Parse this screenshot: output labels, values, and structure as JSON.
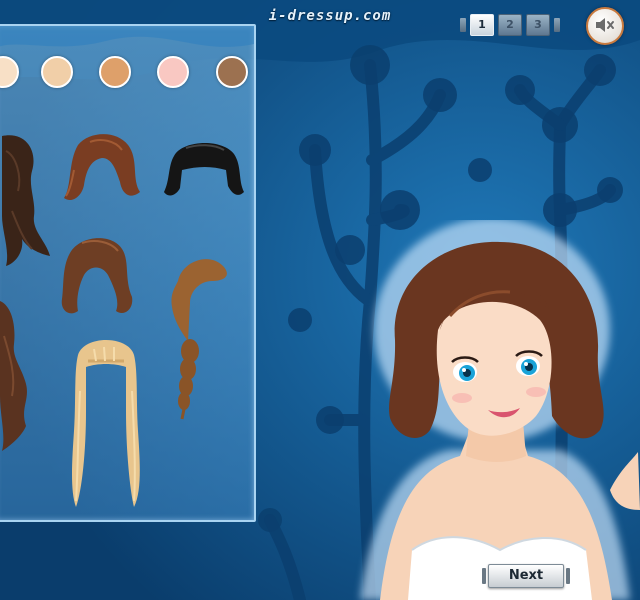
{
  "game": {
    "logo_text": "i-dressup.com",
    "pages": [
      "1",
      "2",
      "3"
    ],
    "active_page": 0,
    "next_label": "Next",
    "sound_icon": "speaker-mute-icon"
  },
  "colors": {
    "background": "#0e4f86",
    "panel_border": "#a9d4f2",
    "accent_orange": "#c97a3e"
  },
  "skin_tones": [
    "#f8e0c6",
    "#f1cfa8",
    "#dea06a",
    "#f9c8c2",
    "#9c7150"
  ],
  "hairstyles": [
    {
      "name": "dark-long-wavy",
      "color": "#3a2418"
    },
    {
      "name": "auburn-bob",
      "color": "#7a3d22"
    },
    {
      "name": "black-bob-bangs",
      "color": "#151515"
    },
    {
      "name": "brown-long-wavy",
      "color": "#5a3320"
    },
    {
      "name": "brown-medium-flip",
      "color": "#6e3e24"
    },
    {
      "name": "light-brown-braid",
      "color": "#9b6331"
    },
    {
      "name": "blonde-long-straight-bangs",
      "color": "#e8c58d"
    }
  ]
}
